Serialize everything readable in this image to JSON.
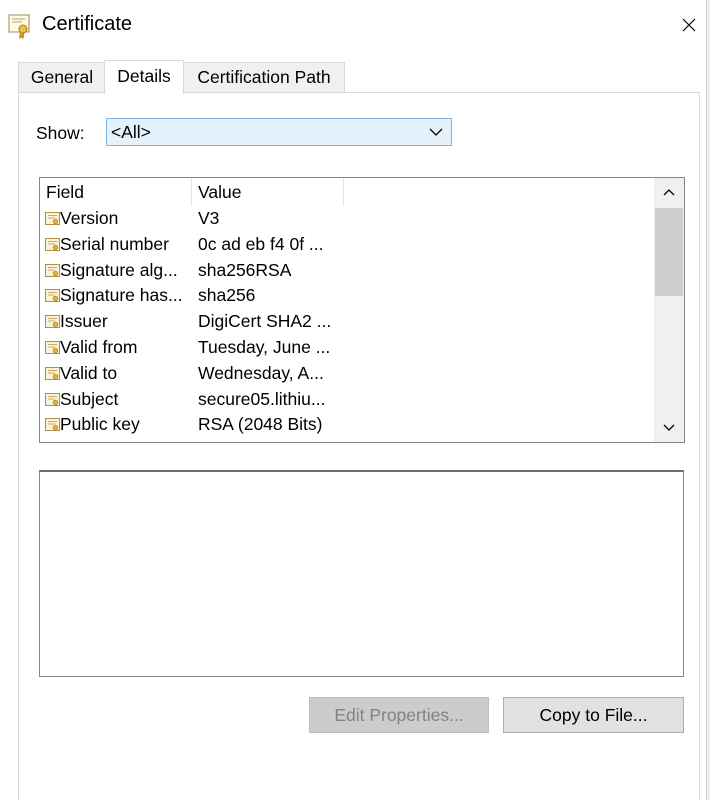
{
  "window": {
    "title": "Certificate",
    "icon": "certificate-icon",
    "close_icon": "close-icon"
  },
  "tabs": [
    {
      "label": "General",
      "active": false
    },
    {
      "label": "Details",
      "active": true
    },
    {
      "label": "Certification Path",
      "active": false
    }
  ],
  "show": {
    "label": "Show:",
    "selected": "<All>",
    "icon": "chevron-down-icon",
    "accent": "#e5f1fb"
  },
  "fields_list": {
    "columns": [
      "Field",
      "Value"
    ],
    "row_icon": "certificate-field-icon",
    "rows": [
      {
        "field": "Version",
        "value": "V3"
      },
      {
        "field": "Serial number",
        "value": "0c ad eb f4 0f ..."
      },
      {
        "field": "Signature alg...",
        "value": "sha256RSA"
      },
      {
        "field": "Signature has...",
        "value": "sha256"
      },
      {
        "field": "Issuer",
        "value": "DigiCert SHA2 ..."
      },
      {
        "field": "Valid from",
        "value": "Tuesday, June ..."
      },
      {
        "field": "Valid to",
        "value": "Wednesday, A..."
      },
      {
        "field": "Subject",
        "value": "secure05.lithiu..."
      },
      {
        "field": "Public key",
        "value": "RSA (2048 Bits)"
      }
    ]
  },
  "buttons": {
    "edit_properties": "Edit Properties...",
    "copy_to_file": "Copy to File..."
  }
}
